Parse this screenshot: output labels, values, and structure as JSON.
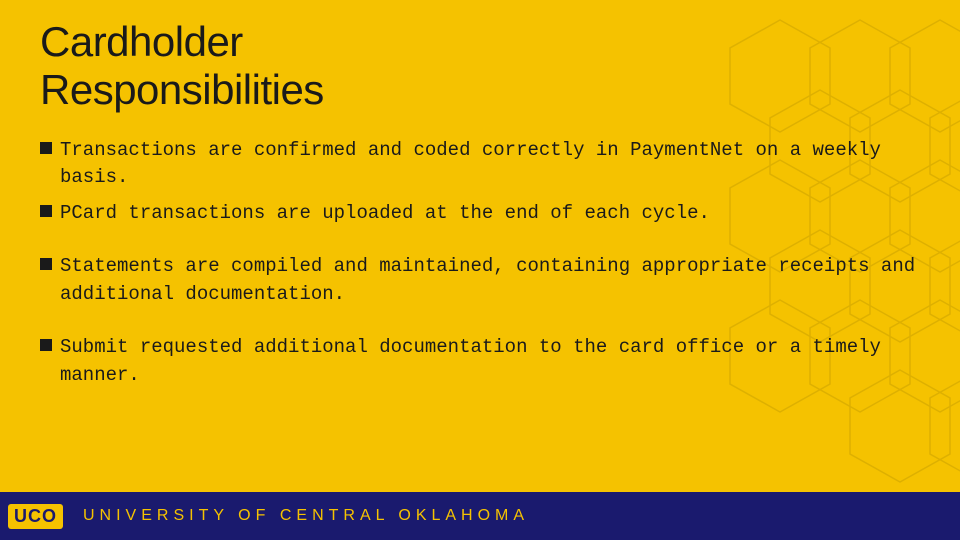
{
  "slide": {
    "background_color": "#F5C200",
    "title_line1": "Cardholder",
    "title_line2": "Responsibilities",
    "bullets": [
      {
        "id": "bullet1",
        "text": "Transactions are confirmed and coded correctly in PaymentNet on a weekly basis."
      },
      {
        "id": "bullet2",
        "text": "PCard transactions are uploaded at the end of each cycle."
      },
      {
        "id": "bullet3",
        "text": "Statements are compiled and maintained, containing appropriate receipts and additional documentation."
      },
      {
        "id": "bullet4",
        "text": "Submit requested additional documentation to the card office or a timely manner."
      }
    ],
    "bottom_bar": {
      "logo_text": "UCO",
      "university_text": "UNIVERSITY  OF  CENTRAL  OKLAHOMA"
    }
  }
}
